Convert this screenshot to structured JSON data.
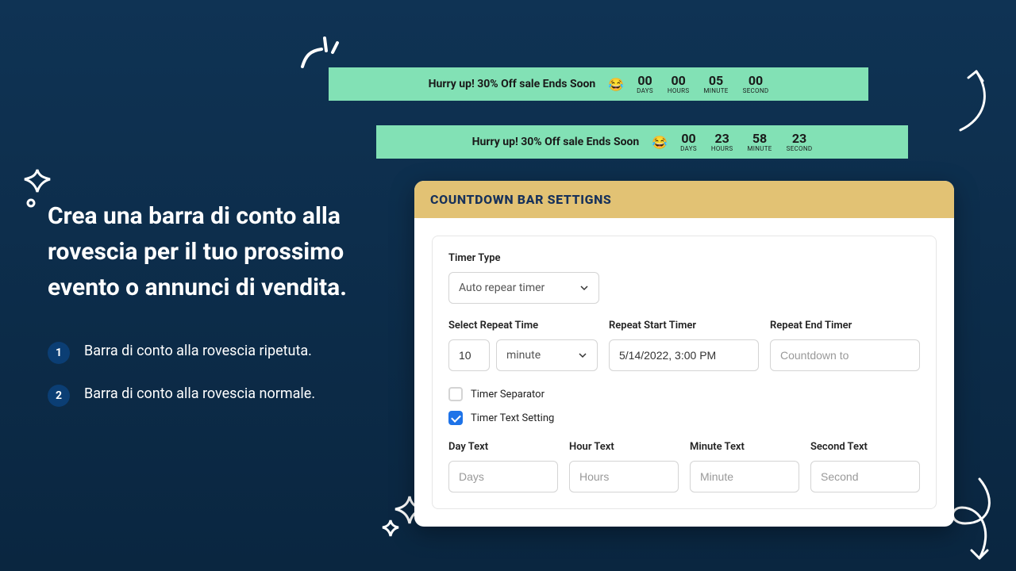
{
  "headline": "Crea una barra di conto alla rovescia per il tuo prossimo evento o annunci di vendita.",
  "bullets": [
    {
      "num": "1",
      "text": "Barra di conto alla rovescia ripetuta."
    },
    {
      "num": "2",
      "text": "Barra di conto alla rovescia normale."
    }
  ],
  "bars": [
    {
      "message": "Hurry up! 30% Off sale Ends Soon",
      "emoji": "😂",
      "units": [
        {
          "num": "00",
          "lbl": "DAYS"
        },
        {
          "num": "00",
          "lbl": "HOURS"
        },
        {
          "num": "05",
          "lbl": "MINUTE"
        },
        {
          "num": "00",
          "lbl": "SECOND"
        }
      ]
    },
    {
      "message": "Hurry up! 30% Off sale Ends Soon",
      "emoji": "😂",
      "units": [
        {
          "num": "00",
          "lbl": "DAYS"
        },
        {
          "num": "23",
          "lbl": "HOURS"
        },
        {
          "num": "58",
          "lbl": "MINUTE"
        },
        {
          "num": "23",
          "lbl": "SECOND"
        }
      ]
    }
  ],
  "card": {
    "title": "COUNTDOWN BAR SETTIGNS",
    "timer_type_label": "Timer Type",
    "timer_type_value": "Auto repear timer",
    "repeat_time_label": "Select Repeat Time",
    "repeat_time_value": "10",
    "repeat_time_unit": "minute",
    "repeat_start_label": "Repeat Start Timer",
    "repeat_start_value": "5/14/2022, 3:00 PM",
    "repeat_end_label": "Repeat End Timer",
    "repeat_end_placeholder": "Countdown to",
    "checkbox_separator": "Timer Separator",
    "checkbox_text_setting": "Timer Text Setting",
    "day_text_label": "Day Text",
    "day_text_placeholder": "Days",
    "hour_text_label": "Hour Text",
    "hour_text_placeholder": "Hours",
    "minute_text_label": "Minute Text",
    "minute_text_placeholder": "Minute",
    "second_text_label": "Second Text",
    "second_text_placeholder": "Second"
  }
}
